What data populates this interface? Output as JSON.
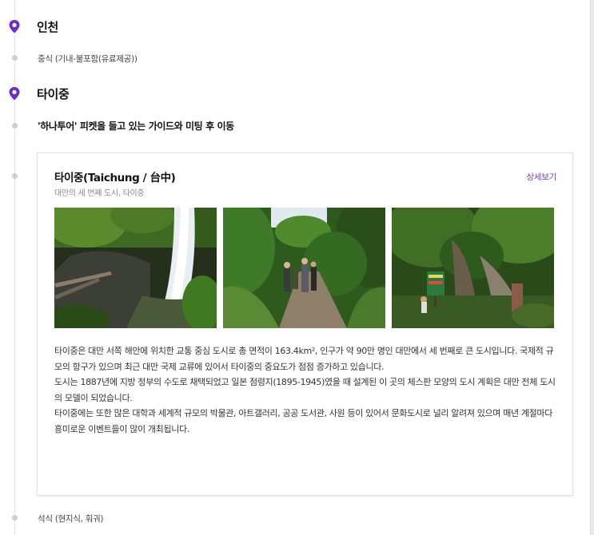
{
  "itinerary": {
    "stop1": {
      "city": "인천",
      "meal": "중식 (기내-불포함(유료제공))"
    },
    "stop2": {
      "city": "타이중",
      "step": "'하나투어' 피켓을 들고 있는 가이드와 미팅 후 이동"
    },
    "card": {
      "title": "타이중(Taichung / 台中)",
      "subtitle": "대만의 세 번째 도시, 타이중",
      "detail_link": "상세보기",
      "description": [
        "타이중은 대만 서쪽 해안에 위치한 교통 중심 도시로 총 면적이 163.4km², 인구가 약 90만 명인 대만에서 세 번째로 큰 도시입니다. 국제적 규모의 항구가 있으며 최근 대만 국제 교류에 있어서 타이중의 중요도가 점점 증가하고 있습니다.",
        "도시는 1887년에 지방 정부의 수도로 채택되었고 일본 점령지(1895-1945)였을 때 설계된 이 곳의 체스판 모양의 도시 계획은 대만 전체 도시의 모델이 되었습니다.",
        "타이중에는 또한 많은 대학과 세계적 규모의 박물관, 아트갤러리, 공공 도서관, 사원 등이 있어서 문화도시로 널리 알려져 있으며 매년 계절마다 흥미로운 이벤트들이 많이 개최됩니다."
      ],
      "photos": [
        "waterfall-photo",
        "forest-trail-photo",
        "forest-sign-photo"
      ]
    },
    "stop3": {
      "meal": "석식 (현지식, 훠궈)"
    }
  },
  "colors": {
    "accent": "#6b3fb3",
    "pin": "#6a2fc6",
    "timeline": "#e4e4e4"
  }
}
